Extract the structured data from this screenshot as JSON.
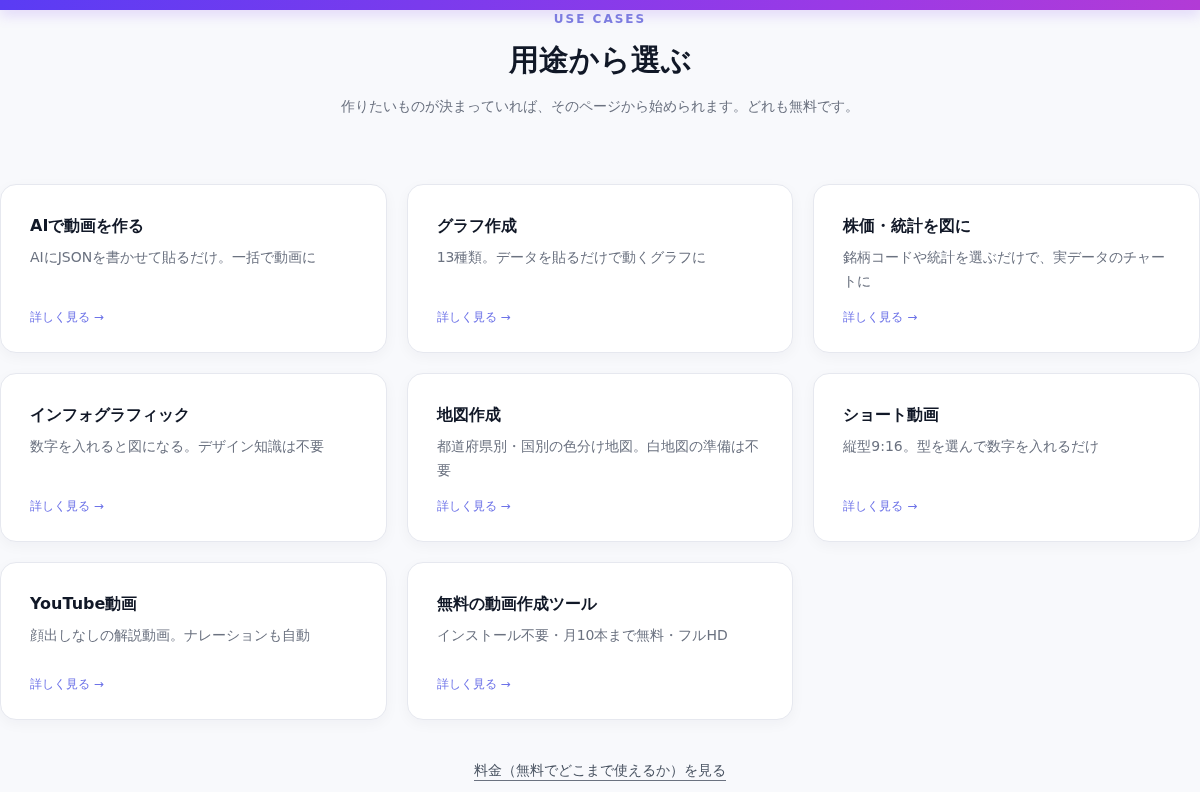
{
  "section": {
    "eyebrow": "USE CASES",
    "title": "用途から選ぶ",
    "subtitle": "作りたいものが決まっていれば、そのページから始められます。どれも無料です。"
  },
  "cards": [
    {
      "title": "AIで動画を作る",
      "description": "AIにJSONを書かせて貼るだけ。一括で動画に",
      "link": "詳しく見る →"
    },
    {
      "title": "グラフ作成",
      "description": "13種類。データを貼るだけで動くグラフに",
      "link": "詳しく見る →"
    },
    {
      "title": "株価・統計を図に",
      "description": "銘柄コードや統計を選ぶだけで、実データのチャートに",
      "link": "詳しく見る →"
    },
    {
      "title": "インフォグラフィック",
      "description": "数字を入れると図になる。デザイン知識は不要",
      "link": "詳しく見る →"
    },
    {
      "title": "地図作成",
      "description": "都道府県別・国別の色分け地図。白地図の準備は不要",
      "link": "詳しく見る →"
    },
    {
      "title": "ショート動画",
      "description": "縦型9:16。型を選んで数字を入れるだけ",
      "link": "詳しく見る →"
    },
    {
      "title": "YouTube動画",
      "description": "顔出しなしの解説動画。ナレーションも自動",
      "link": "詳しく見る →"
    },
    {
      "title": "無料の動画作成ツール",
      "description": "インストール不要・月10本まで無料・フルHD",
      "link": "詳しく見る →"
    }
  ],
  "footer_link": "料金（無料でどこまで使えるか）を見る"
}
